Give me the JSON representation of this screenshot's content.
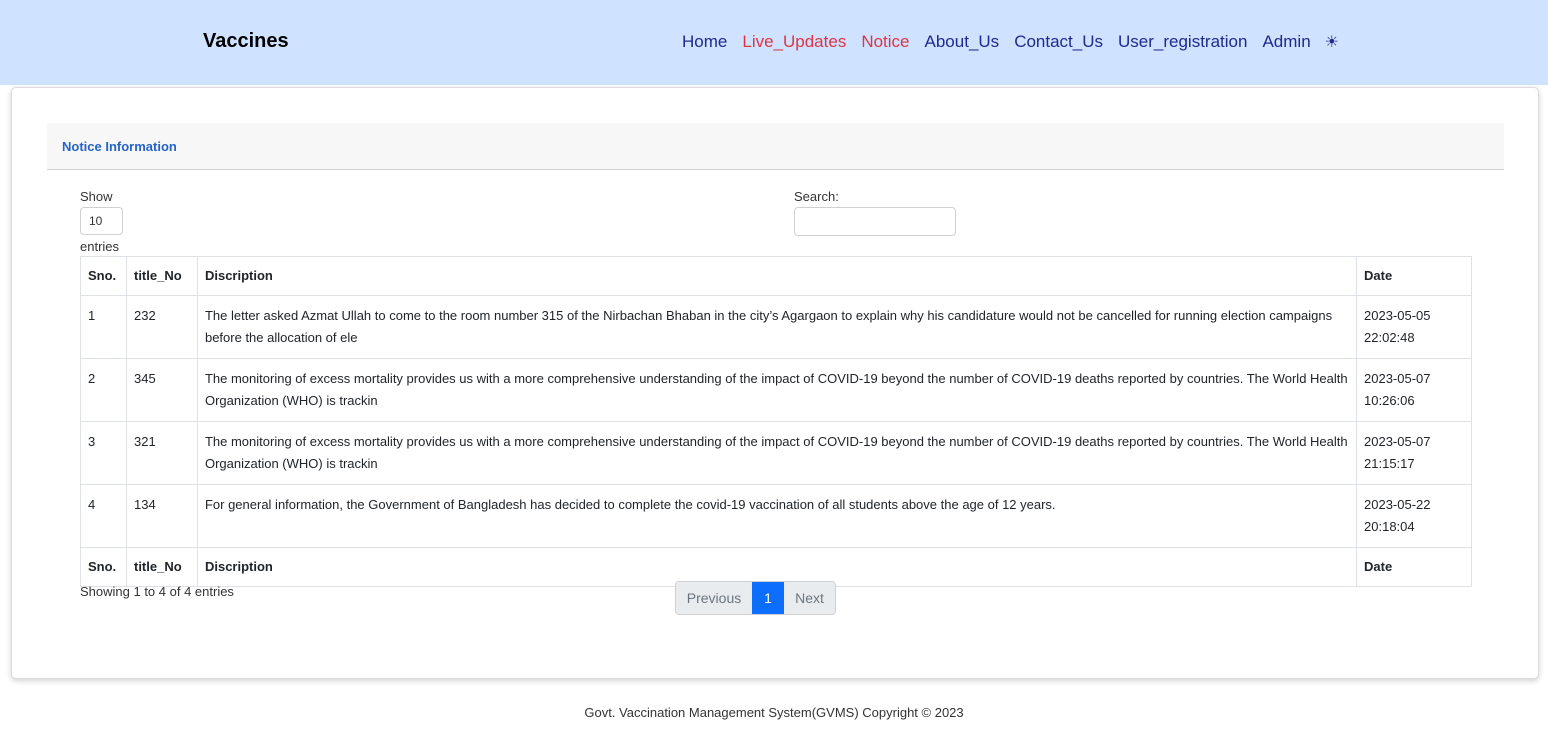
{
  "navbar": {
    "brand": "Vaccines",
    "links": [
      {
        "label": "Home"
      },
      {
        "label": "Live_Updates"
      },
      {
        "label": "Notice"
      },
      {
        "label": "About_Us"
      },
      {
        "label": "Contact_Us"
      },
      {
        "label": "User_registration"
      },
      {
        "label": "Admin"
      }
    ],
    "theme_icon": "☀",
    "colors": {
      "nav_link": "#1e2a8c",
      "active_link": "#dc3545",
      "background": "#cfe2ff"
    }
  },
  "card": {
    "header": "Notice Information",
    "length": {
      "show_label": "Show",
      "value": "10",
      "entries_label": "entries"
    },
    "search": {
      "label": "Search:",
      "value": ""
    },
    "table": {
      "columns": [
        "Sno.",
        "title_No",
        "Discription",
        "Date"
      ],
      "rows": [
        {
          "sno": "1",
          "title_no": "232",
          "description": "The letter asked Azmat Ullah to come to the room number 315 of the Nirbachan Bhaban in the city’s Agargaon to explain why his candidature would not be cancelled for running election campaigns before the allocation of ele",
          "date": "2023-05-05",
          "time": "22:02:48"
        },
        {
          "sno": "2",
          "title_no": "345",
          "description": "The monitoring of excess mortality provides us with a more comprehensive understanding of the impact of COVID-19 beyond the number of COVID-19 deaths reported by countries. The World Health Organization (WHO) is trackin",
          "date": "2023-05-07",
          "time": "10:26:06"
        },
        {
          "sno": "3",
          "title_no": "321",
          "description": "The monitoring of excess mortality provides us with a more comprehensive understanding of the impact of COVID-19 beyond the number of COVID-19 deaths reported by countries. The World Health Organization (WHO) is trackin",
          "date": "2023-05-07",
          "time": "21:15:17"
        },
        {
          "sno": "4",
          "title_no": "134",
          "description": "For general information, the Government of Bangladesh has decided to complete the covid-19 vaccination of all students above the age of 12 years.",
          "date": "2023-05-22",
          "time": "20:18:04"
        }
      ],
      "footer_columns": [
        "Sno.",
        "title_No",
        "Discription",
        "Date"
      ]
    },
    "info": "Showing 1 to 4 of 4 entries",
    "pagination": {
      "previous": "Previous",
      "current": "1",
      "next": "Next",
      "active_color": "#0d6efd"
    }
  },
  "footer": {
    "text": "Govt. Vaccination Management System(GVMS) Copyright © 2023"
  }
}
